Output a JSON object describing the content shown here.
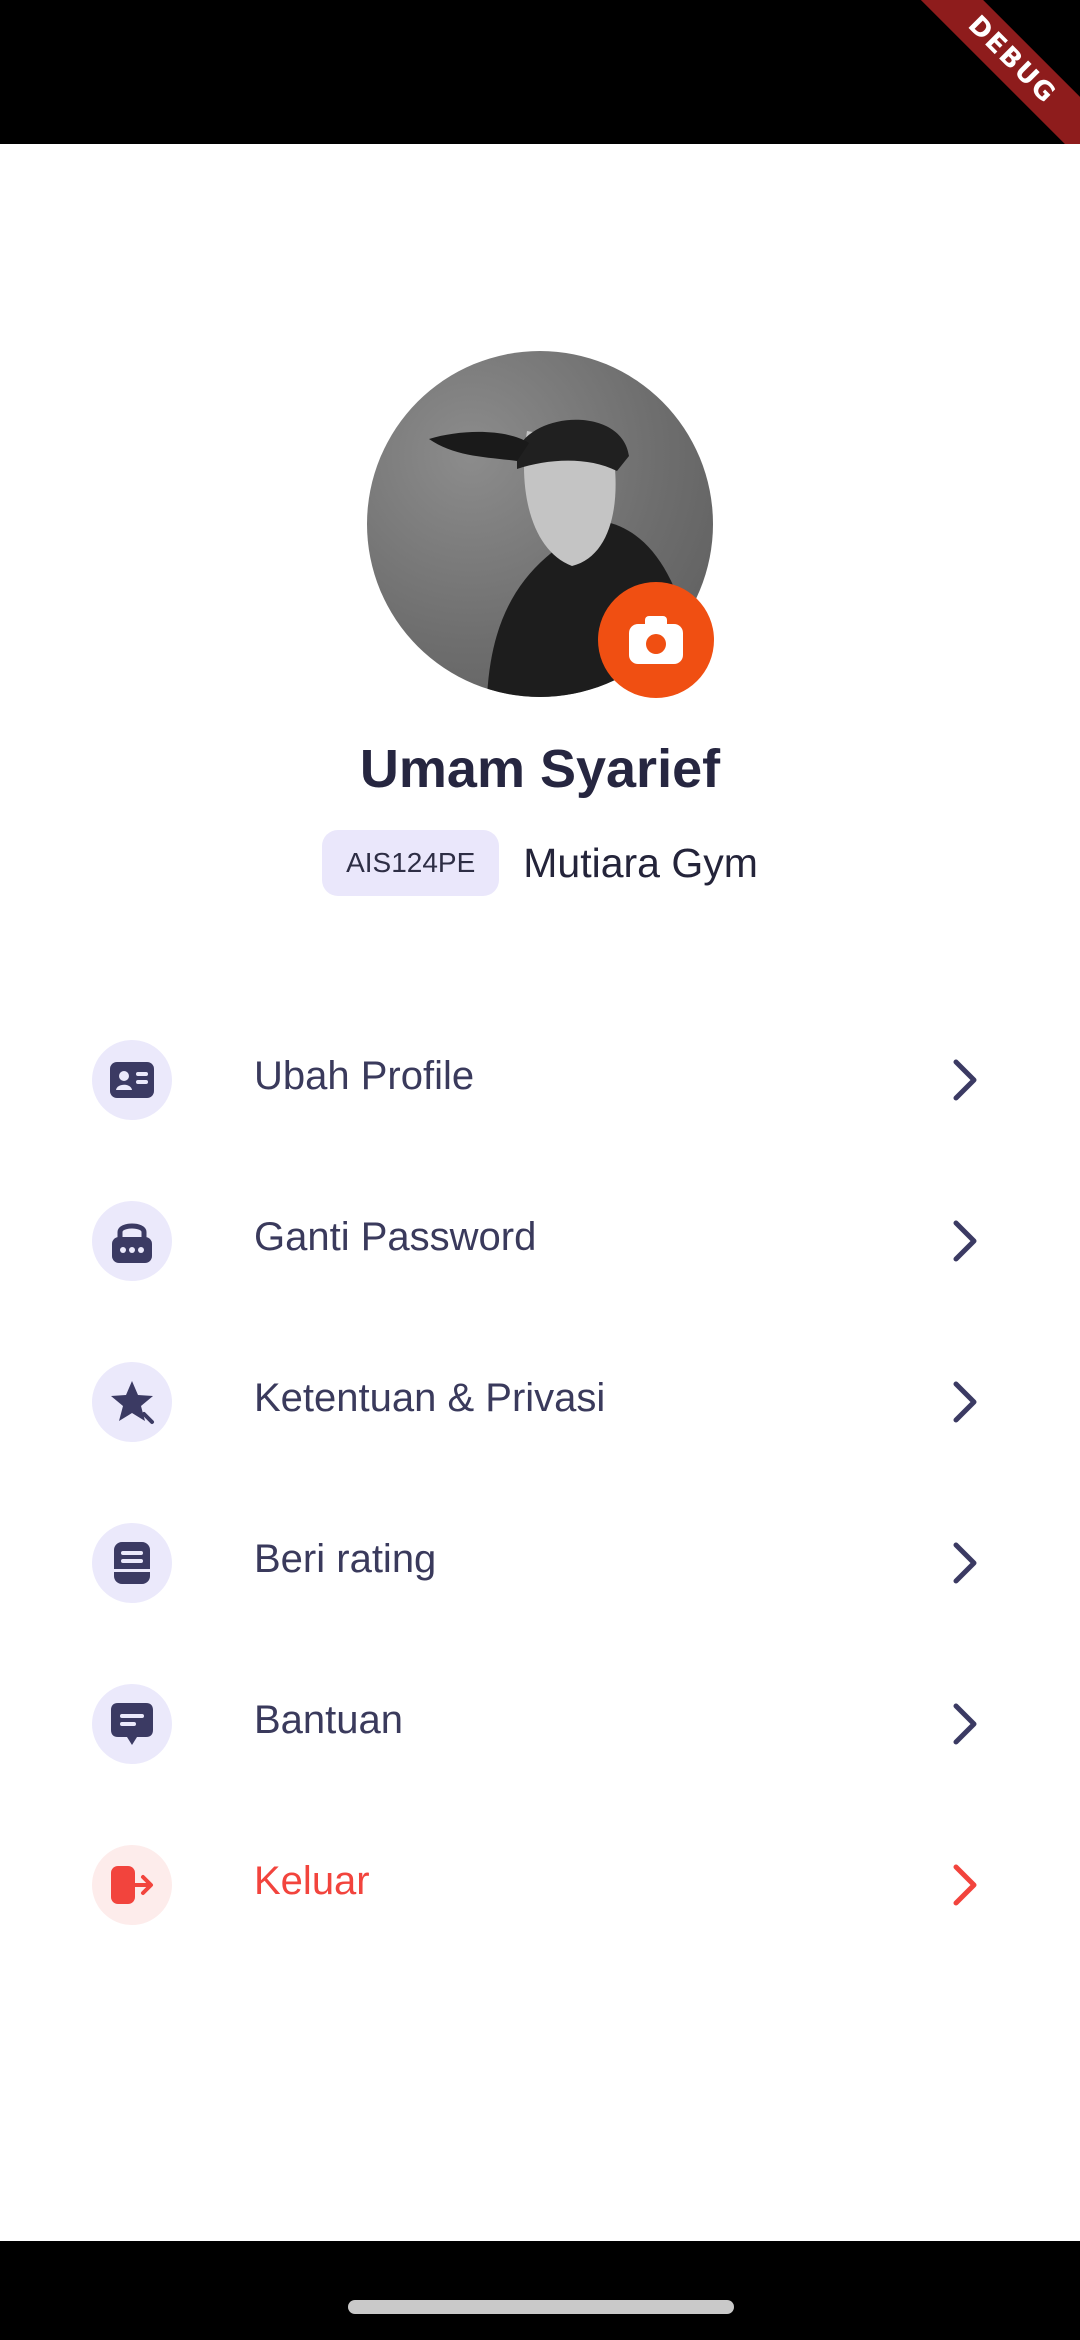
{
  "debug_ribbon": "DEBUG",
  "profile": {
    "name": "Umam Syarief",
    "member_id": "AIS124PE",
    "gym": "Mutiara Gym"
  },
  "menu": [
    {
      "label": "Ubah Profile",
      "icon": "id-card-icon"
    },
    {
      "label": "Ganti Password",
      "icon": "lock-icon"
    },
    {
      "label": "Ketentuan & Privasi",
      "icon": "star-icon"
    },
    {
      "label": "Beri rating",
      "icon": "document-icon"
    },
    {
      "label": "Bantuan",
      "icon": "chat-bubble-icon"
    },
    {
      "label": "Keluar",
      "icon": "logout-icon"
    }
  ],
  "colors": {
    "accent": "#f04f12",
    "text_primary": "#262640",
    "menu_text": "#3a3a5c",
    "danger": "#f2443d",
    "icon_bg": "#ebe9fb",
    "danger_bg": "#fdeceb"
  }
}
